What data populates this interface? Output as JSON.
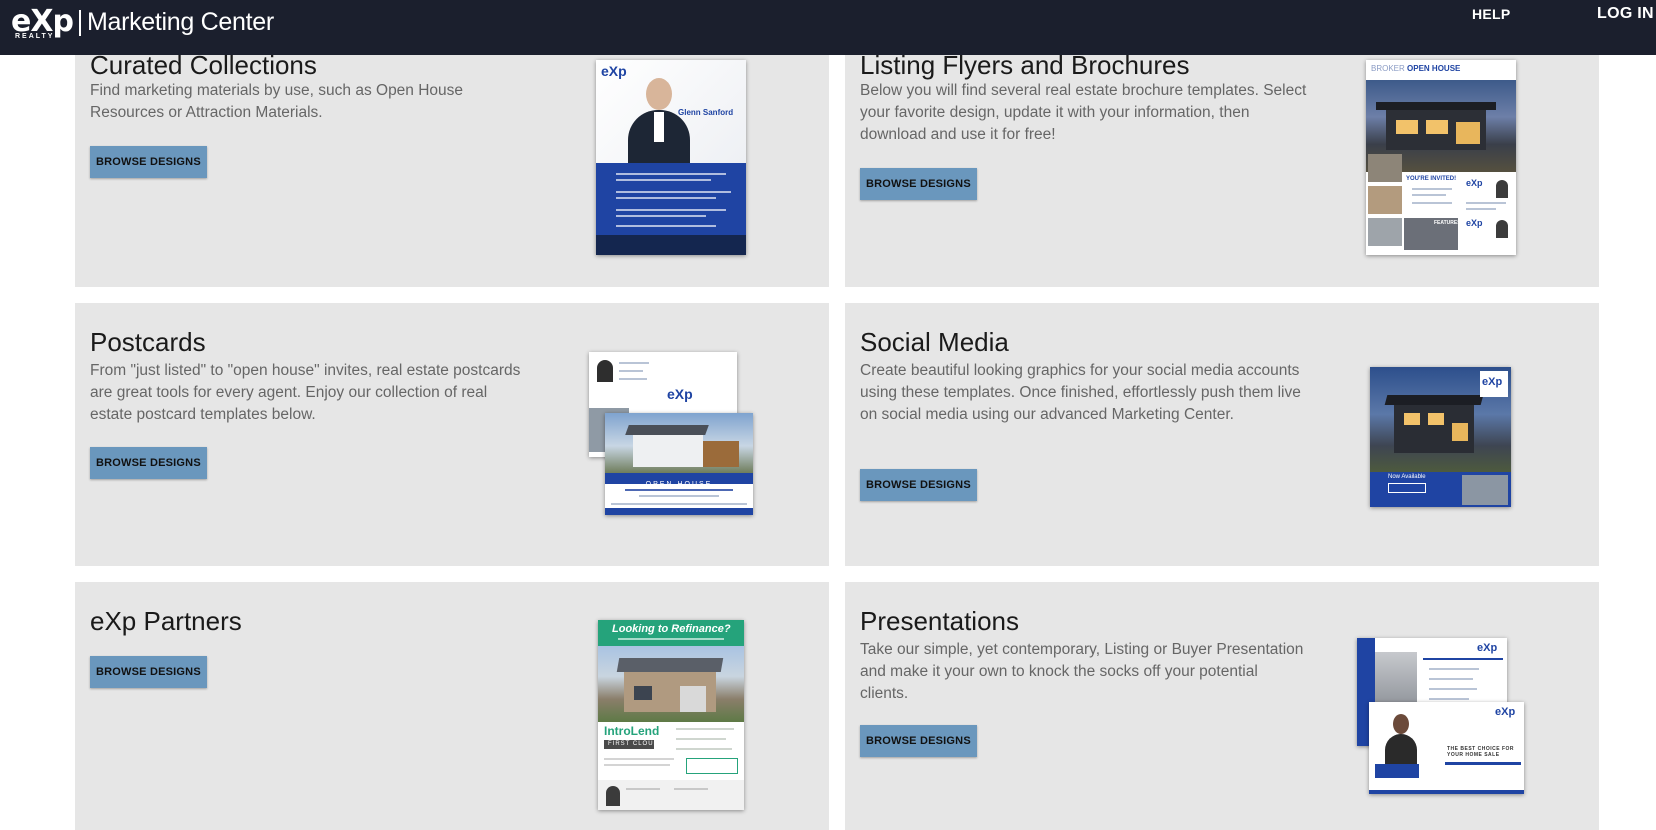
{
  "header": {
    "logo": {
      "mark": "eXp",
      "sub": "REALTY",
      "name": "Marketing Center"
    },
    "nav": {
      "help": "HELP",
      "login": "LOG IN"
    }
  },
  "cards": {
    "curated": {
      "title": "Curated Collections",
      "description": "Find marketing materials by use, such as Open House Resources or Attraction Materials.",
      "button": "BROWSE DESIGNS",
      "thumb": {
        "brand": "eXp",
        "person": "Glenn Sanford"
      }
    },
    "flyers": {
      "title": "Listing Flyers and Brochures",
      "description": "Below you will find several real estate brochure templates. Select your favorite design, update it with your information, then download and use it for free!",
      "button": "BROWSE DESIGNS",
      "thumb": {
        "heading_light": "BROKER",
        "heading_bold": "OPEN HOUSE",
        "invite": "YOU'RE INVITED!",
        "features": "FEATURES"
      }
    },
    "postcards": {
      "title": "Postcards",
      "description": "From \"just listed\" to \"open house\" invites, real estate postcards are great tools for every agent. Enjoy our collection of real estate postcard templates below.",
      "button": "BROWSE DESIGNS",
      "thumb": {
        "brand": "eXp",
        "banner": "OPEN HOUSE"
      }
    },
    "social": {
      "title": "Social Media",
      "description": "Create beautiful looking graphics for your social media accounts using these templates. Once finished, effortlessly push them live on social media using our advanced Marketing Center.",
      "button": "BROWSE DESIGNS",
      "thumb": {
        "brand": "eXp",
        "caption": "Now Available"
      }
    },
    "partners": {
      "title": "eXp Partners",
      "button": "BROWSE DESIGNS",
      "thumb": {
        "headline": "Looking to Refinance?",
        "brand": "IntroLend",
        "sub": "FIRST CLOUD"
      }
    },
    "presentations": {
      "title": "Presentations",
      "description": "Take our simple, yet contemporary, Listing or Buyer Presentation and make it your own to knock the socks off your potential clients.",
      "button": "BROWSE DESIGNS",
      "thumb": {
        "brand": "eXp",
        "tagline": "THE BEST CHOICE FOR YOUR HOME SALE"
      }
    }
  },
  "colors": {
    "header_bg": "#1b1f2d",
    "card_bg": "#e6e6e6",
    "button_bg": "#6a97bd",
    "brand_blue": "#1f44a3",
    "partner_green": "#25a37b"
  }
}
